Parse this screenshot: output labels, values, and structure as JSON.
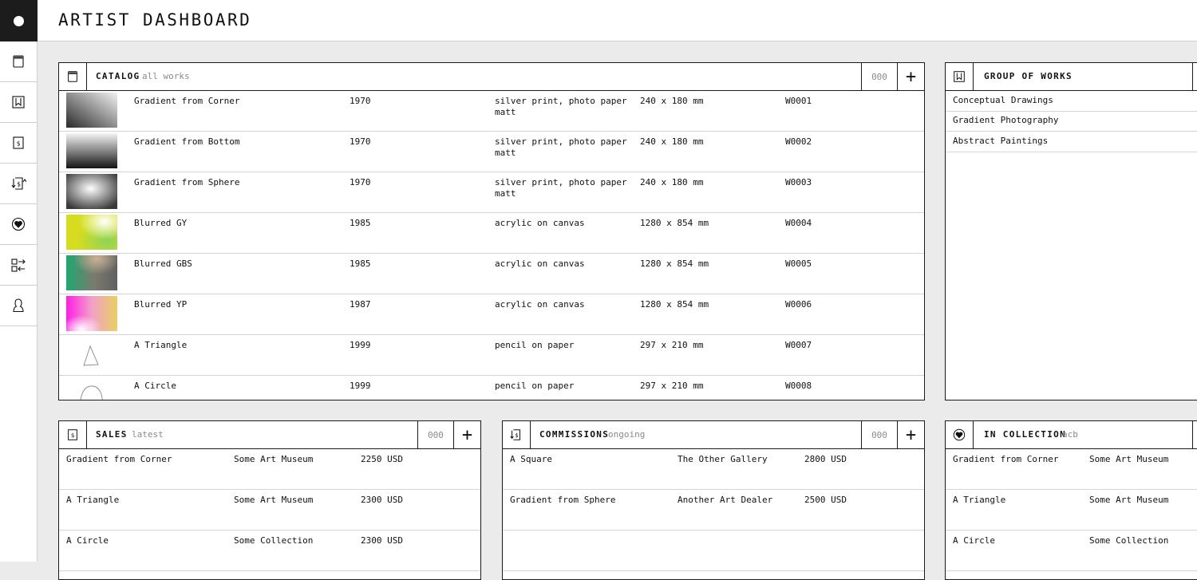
{
  "app": {
    "title": "ARTIST DASHBOARD"
  },
  "sidebar": {
    "items": [
      {
        "icon": "catalog-icon"
      },
      {
        "icon": "bookmark-icon"
      },
      {
        "icon": "dollar-icon"
      },
      {
        "icon": "commission-icon"
      },
      {
        "icon": "heart-icon"
      },
      {
        "icon": "transfer-icon"
      },
      {
        "icon": "user-icon"
      }
    ]
  },
  "catalog": {
    "title": "CATALOG",
    "subtitle": "all works",
    "count": "000",
    "add_label": "+",
    "rows": [
      {
        "title": "Gradient from Corner",
        "year": "1970",
        "medium": "silver print, photo paper matt",
        "size": "240 x 180 mm",
        "id": "W0001"
      },
      {
        "title": "Gradient from Bottom",
        "year": "1970",
        "medium": "silver print, photo paper matt",
        "size": "240 x 180 mm",
        "id": "W0002"
      },
      {
        "title": "Gradient from Sphere",
        "year": "1970",
        "medium": "silver print, photo paper matt",
        "size": "240 x 180 mm",
        "id": "W0003"
      },
      {
        "title": "Blurred GY",
        "year": "1985",
        "medium": "acrylic on canvas",
        "size": "1280 x 854 mm",
        "id": "W0004"
      },
      {
        "title": "Blurred GBS",
        "year": "1985",
        "medium": "acrylic on canvas",
        "size": "1280 x 854 mm",
        "id": "W0005"
      },
      {
        "title": "Blurred YP",
        "year": "1987",
        "medium": "acrylic on canvas",
        "size": "1280 x 854 mm",
        "id": "W0006"
      },
      {
        "title": "A Triangle",
        "year": "1999",
        "medium": "pencil on paper",
        "size": "297 x 210 mm",
        "id": "W0007"
      },
      {
        "title": "A Circle",
        "year": "1999",
        "medium": "pencil on paper",
        "size": "297 x 210 mm",
        "id": "W0008"
      }
    ]
  },
  "groups": {
    "title": "GROUP OF WORKS",
    "items": [
      "Conceptual Drawings",
      "Gradient Photography",
      "Abstract Paintings"
    ]
  },
  "sales": {
    "title": "SALES",
    "subtitle": "latest",
    "count": "000",
    "add_label": "+",
    "rows": [
      {
        "work": "Gradient from Corner",
        "buyer": "Some Art Museum",
        "price": "2250 USD"
      },
      {
        "work": "A Triangle",
        "buyer": "Some Art Museum",
        "price": "2300 USD"
      },
      {
        "work": "A Circle",
        "buyer": "Some Collection",
        "price": "2300 USD"
      }
    ]
  },
  "commissions": {
    "title": "COMMISSIONS",
    "subtitle": "ongoing",
    "count": "000",
    "add_label": "+",
    "rows": [
      {
        "work": "A Square",
        "client": "The Other Gallery",
        "price": "2800 USD"
      },
      {
        "work": "Gradient from Sphere",
        "client": "Another Art Dealer",
        "price": "2500 USD"
      }
    ]
  },
  "collection": {
    "title": "IN COLLECTION",
    "subtitle": "acb",
    "rows": [
      {
        "work": "Gradient from Corner",
        "owner": "Some Art Museum"
      },
      {
        "work": "A Triangle",
        "owner": "Some Art Museum"
      },
      {
        "work": "A Circle",
        "owner": "Some Collection"
      }
    ]
  }
}
